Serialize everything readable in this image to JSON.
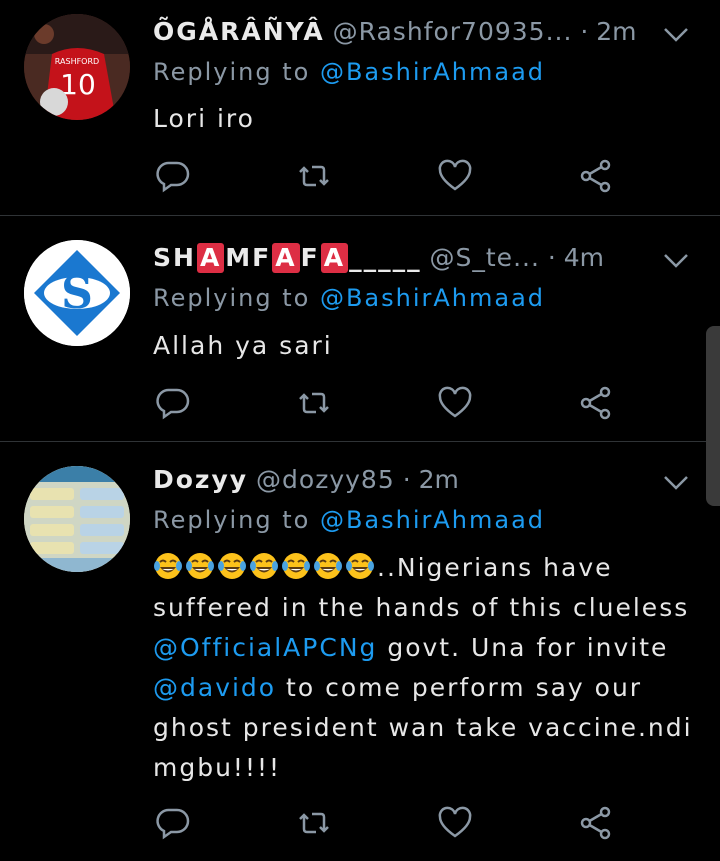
{
  "tweets": [
    {
      "name": "ÕGÅRÂÑYÂ",
      "handle": "@Rashfor70935...",
      "time": "· 2m",
      "replying_prefix": "Replying to",
      "replying_to": "@BashirAhmaad",
      "text": "Lori iro",
      "avatar_text": "10"
    },
    {
      "name_parts": [
        "SH",
        "A",
        "MF",
        "A",
        "F",
        "A",
        "_____"
      ],
      "handle": "@S_te...",
      "time": "· 4m",
      "replying_prefix": "Replying to",
      "replying_to": "@BashirAhmaad",
      "text": "Allah ya sari",
      "avatar_text": "S"
    },
    {
      "name": "Dozyy",
      "handle": "@dozyy85",
      "time": "· 2m",
      "replying_prefix": "Replying to",
      "replying_to": "@BashirAhmaad",
      "text_part1": "..Nigerians have suffered in the hands of this clueless",
      "mention1": "@OfficialAPCNg",
      "text_part2": " govt. Una for invite",
      "mention2": "@davido",
      "text_part3": " to come perform say our ghost president wan take vaccine.ndi mgbu!!!!",
      "emoji_name": "face-with-tears-of-joy",
      "emoji_count": 7
    }
  ],
  "colors": {
    "background": "#000000",
    "accent": "#1d9bf0",
    "secondary_text": "#8b98a5",
    "name_highlight": "#dd2e44"
  },
  "icons": [
    "reply-icon",
    "retweet-icon",
    "like-icon",
    "share-icon",
    "chevron-down-icon"
  ]
}
